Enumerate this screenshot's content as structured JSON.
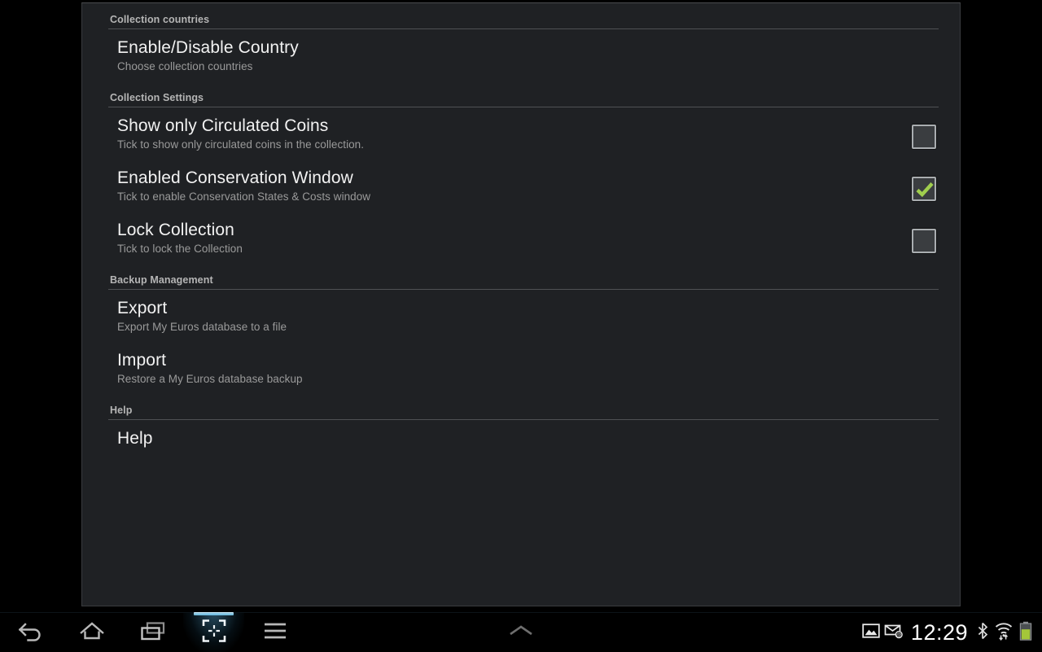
{
  "colors": {
    "panel_bg": "#1f2124",
    "outer_bg": "#000000",
    "title_text": "#f2f2f2",
    "summary_text": "#9a9a9a",
    "section_header_text": "#b5b5b5",
    "divider": "#4f5154",
    "checkbox_border": "#a9adb0",
    "checkbox_fill": "#3a3d40",
    "check_green": "#a0ce4e",
    "navbar_bg": "#000000",
    "nav_icon": "#b8b8b8",
    "nav_highlight": "#6fc0e0",
    "battery_green": "#a4c639",
    "clock_text": "#ffffff"
  },
  "app": {
    "screen_name": "settings",
    "sections": [
      {
        "header": "Collection countries",
        "items": [
          {
            "title": "Enable/Disable Country",
            "summary": "Choose collection countries",
            "widget": "none"
          }
        ]
      },
      {
        "header": "Collection Settings",
        "items": [
          {
            "title": "Show only Circulated Coins",
            "summary": "Tick to show only circulated coins in the collection.",
            "widget": "checkbox",
            "checked": false
          },
          {
            "title": "Enabled Conservation Window",
            "summary": "Tick to enable Conservation States & Costs window",
            "widget": "checkbox",
            "checked": true
          },
          {
            "title": "Lock Collection",
            "summary": "Tick to lock the Collection",
            "widget": "checkbox",
            "checked": false
          }
        ]
      },
      {
        "header": "Backup Management",
        "items": [
          {
            "title": "Export",
            "summary": "Export My Euros database to a file",
            "widget": "none"
          },
          {
            "title": "Import",
            "summary": "Restore a My Euros database backup",
            "widget": "none"
          }
        ]
      },
      {
        "header": "Help",
        "items": [
          {
            "title": "Help",
            "summary": "",
            "widget": "none"
          }
        ]
      }
    ]
  },
  "navbar": {
    "buttons": [
      {
        "icon": "back-icon",
        "label": "Back"
      },
      {
        "icon": "home-icon",
        "label": "Home"
      },
      {
        "icon": "recent-apps-icon",
        "label": "Recent apps"
      },
      {
        "icon": "screenshot-icon",
        "label": "Screenshot",
        "active": true
      },
      {
        "icon": "menu-icon",
        "label": "Menu"
      }
    ],
    "drawer_handle_icon": "chevron-up-icon",
    "status": {
      "notification_icons": [
        "screenshot-notification-icon",
        "email-icon"
      ],
      "clock": "12:29",
      "system_icons": [
        "bluetooth-icon",
        "wifi-icon",
        "battery-icon"
      ],
      "battery_level_percent": 65
    }
  }
}
